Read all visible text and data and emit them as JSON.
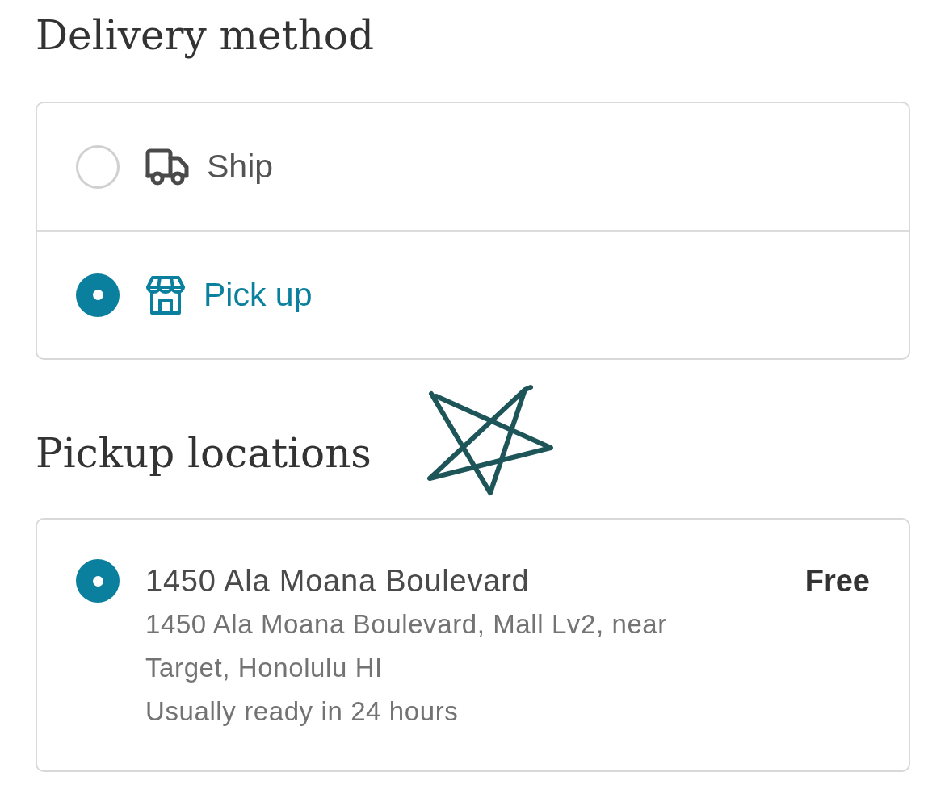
{
  "delivery": {
    "heading": "Delivery method",
    "options": [
      {
        "kind": "ship",
        "label": "Ship",
        "selected": false
      },
      {
        "kind": "pickup",
        "label": "Pick up",
        "selected": true
      }
    ]
  },
  "pickup": {
    "heading": "Pickup locations",
    "locations": [
      {
        "name": "1450 Ala Moana Boulevard",
        "address": "1450 Ala Moana Boulevard, Mall Lv2, near Target, Honolulu HI",
        "note": "Usually ready in 24 hours",
        "price": "Free",
        "selected": true
      }
    ]
  }
}
